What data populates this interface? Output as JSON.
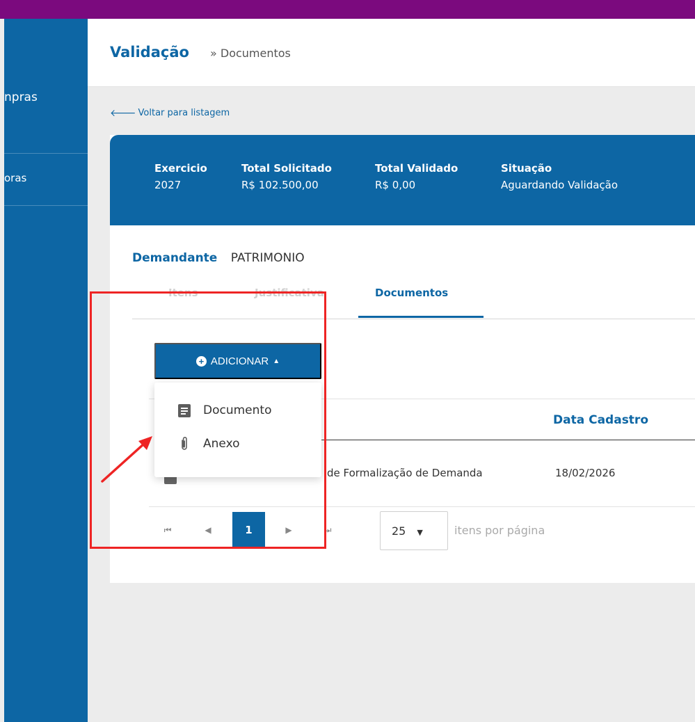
{
  "sidebar": {
    "items": [
      {
        "label": "npras"
      },
      {
        "label": "oras"
      }
    ]
  },
  "header": {
    "title": "Validação",
    "breadcrumb": "» Documentos"
  },
  "back_link": {
    "label": "Voltar para listagem"
  },
  "summary": {
    "fields": [
      {
        "label": "Exercicio",
        "value": "2027"
      },
      {
        "label": "Total Solicitado",
        "value": "R$ 102.500,00"
      },
      {
        "label": "Total Validado",
        "value": "R$ 0,00"
      },
      {
        "label": "Situação",
        "value": "Aguardando Validação"
      }
    ]
  },
  "demandante": {
    "label": "Demandante",
    "value": "PATRIMONIO"
  },
  "tabs": [
    {
      "label": "Itens"
    },
    {
      "label": "Justificativa"
    },
    {
      "label": "Documentos",
      "active": true
    }
  ],
  "add_button": {
    "label": "ADICIONAR"
  },
  "dropdown": {
    "items": [
      {
        "label": "Documento",
        "icon": "document-icon"
      },
      {
        "label": "Anexo",
        "icon": "paperclip-icon"
      }
    ]
  },
  "grid": {
    "columns": [
      {
        "label": "Data Cadastro"
      }
    ],
    "rows": [
      {
        "name": "de Formalização de Demanda",
        "date": "18/02/2026"
      }
    ]
  },
  "pager": {
    "current_page": "1",
    "page_size": "25",
    "per_page_label": "itens por página"
  },
  "colors": {
    "primary": "#0d66a4",
    "topbar": "#7b0a7e",
    "highlight": "#ee2424"
  }
}
